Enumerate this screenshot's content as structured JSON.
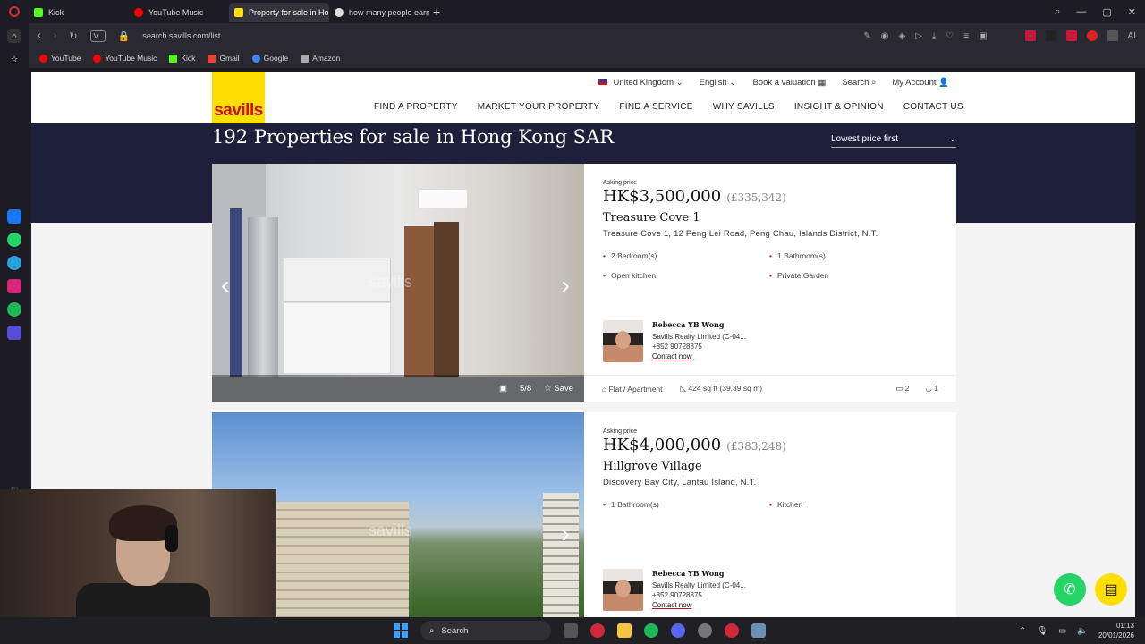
{
  "browser": {
    "tabs": [
      {
        "label": "Kick",
        "color": "#53fc18",
        "active": false
      },
      {
        "label": "YouTube Music",
        "color": "#ff0000",
        "active": false
      },
      {
        "label": "Property for sale in Hong",
        "color": "#ffdf00",
        "active": true
      },
      {
        "label": "how many people earns m",
        "color": "#dddddd",
        "active": false
      }
    ],
    "new_tab": "+",
    "url": "search.savills.com/list",
    "addr_badge": "V..",
    "bookmarks": [
      {
        "label": "YouTube",
        "color": "#ff0000"
      },
      {
        "label": "YouTube Music",
        "color": "#ff0000"
      },
      {
        "label": "Kick",
        "color": "#53fc18"
      },
      {
        "label": "Gmail",
        "color": "#ea4335"
      },
      {
        "label": "Google",
        "color": "#4285f4"
      },
      {
        "label": "Amazon",
        "color": "#333333"
      }
    ]
  },
  "site": {
    "logo": "savills",
    "util_nav": {
      "country": "United Kingdom",
      "language": "English",
      "valuation": "Book a valuation",
      "search": "Search",
      "account": "My Account"
    },
    "main_nav": [
      "FIND A PROPERTY",
      "MARKET YOUR PROPERTY",
      "FIND A SERVICE",
      "WHY SAVILLS",
      "INSIGHT & OPINION",
      "CONTACT US"
    ],
    "results_title": "192 Properties for sale in Hong Kong SAR",
    "sort": "Lowest price first"
  },
  "listings": [
    {
      "ask_label": "Asking price",
      "price": "HK$3,500,000",
      "price_gbp": "(£335,342)",
      "name": "Treasure Cove 1",
      "address": "Treasure Cove 1, 12 Peng Lei Road, Peng Chau, Islands District, N.T.",
      "features": [
        "2 Bedroom(s)",
        "1 Bathroom(s)",
        "Open kitchen",
        "Private Garden"
      ],
      "agent_name": "Rebecca YB Wong",
      "agent_company": "Savills Realty Limited (C-04...",
      "agent_phone": "+852 90728875",
      "contact": "Contact now",
      "photo_count": "5/8",
      "save": "Save",
      "type": "Flat / Apartment",
      "size": "424 sq ft (39.39 sq m)",
      "beds": "2",
      "baths": "1",
      "watermark": "savills"
    },
    {
      "ask_label": "Asking price",
      "price": "HK$4,000,000",
      "price_gbp": "(£383,248)",
      "name": "Hillgrove Village",
      "address": "Discovery Bay City, Lantau Island, N.T.",
      "features": [
        "1 Bathroom(s)",
        "Kitchen"
      ],
      "agent_name": "Rebecca YB Wong",
      "agent_company": "Savills Realty Limited (C-04...",
      "agent_phone": "+852 90728875",
      "contact": "Contact now",
      "watermark": "savills"
    }
  ],
  "taskbar": {
    "search": "Search",
    "time": "01:13",
    "date": "20/01/2026"
  },
  "colors": {
    "brand_yellow": "#ffdf00",
    "brand_red": "#c8102e",
    "navy": "#1e1f3a",
    "whatsapp": "#25d366"
  }
}
